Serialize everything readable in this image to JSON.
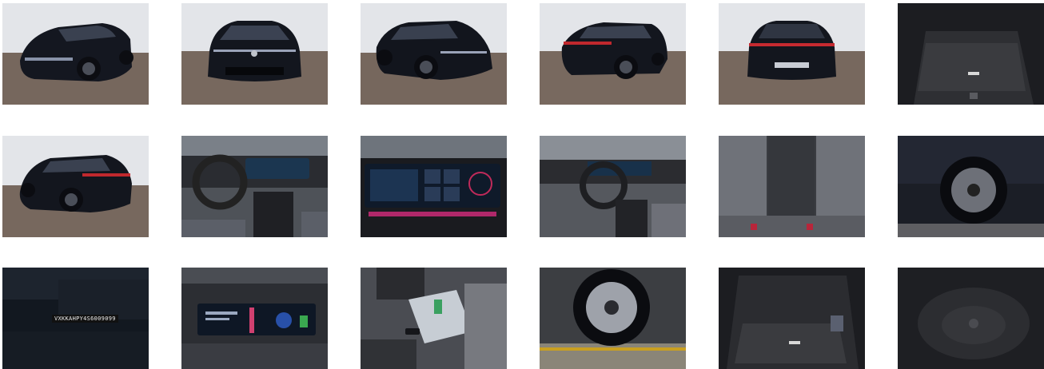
{
  "gallery": {
    "photos": [
      {
        "id": "exterior-front-left",
        "kind": "studio-car"
      },
      {
        "id": "exterior-front",
        "kind": "studio-car"
      },
      {
        "id": "exterior-front-right",
        "kind": "studio-car"
      },
      {
        "id": "exterior-rear-right",
        "kind": "studio-car"
      },
      {
        "id": "exterior-rear",
        "kind": "studio-car"
      },
      {
        "id": "trunk",
        "kind": "trunk"
      },
      {
        "id": "exterior-rear-left",
        "kind": "studio-car"
      },
      {
        "id": "dashboard",
        "kind": "interior"
      },
      {
        "id": "infotainment-screen",
        "kind": "screen"
      },
      {
        "id": "driver-cockpit",
        "kind": "interior"
      },
      {
        "id": "rear-seats",
        "kind": "seats"
      },
      {
        "id": "front-wheel",
        "kind": "wheel"
      },
      {
        "id": "vin-plate",
        "kind": "vin",
        "vin": "VXKKAHPY4S6009099"
      },
      {
        "id": "instrument-cluster",
        "kind": "screen"
      },
      {
        "id": "documents-and-key",
        "kind": "interior"
      },
      {
        "id": "wheel-closeup",
        "kind": "wheel"
      },
      {
        "id": "trunk-floor",
        "kind": "trunk"
      },
      {
        "id": "spare-well",
        "kind": "trunk"
      }
    ]
  },
  "colors": {
    "studio_wall": "#e4e6ea",
    "studio_floor": "#7a6a60",
    "car_body": "#14171f",
    "interior_dark": "#2b2d33",
    "seat_grey": "#6d7078"
  }
}
